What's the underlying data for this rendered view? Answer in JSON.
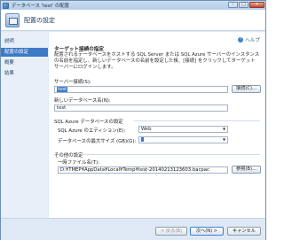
{
  "window": {
    "title": "データベース 'test' の配置",
    "controls": {
      "minimize": "–",
      "maximize": "□",
      "close": "✕"
    }
  },
  "header": {
    "title": "配置の設定"
  },
  "nav": {
    "items": [
      {
        "label": "説明",
        "selected": false
      },
      {
        "label": "配置の設定",
        "selected": true
      },
      {
        "label": "概要",
        "selected": false
      },
      {
        "label": "結果",
        "selected": false
      }
    ]
  },
  "help": {
    "label": "ヘルプ",
    "icon": "help-icon"
  },
  "target": {
    "section_title": "ターゲット接続の指定",
    "description": "配置されるデータベースをホストする SQL Server または SQL Azure サーバーのインスタンスの名前を指定し、新しいデータベースの名前を設定した後、[接続] をクリックしてターゲット サーバーにログインします。",
    "server_label": "サーバー接続(S):",
    "server_value": "test",
    "connect_button": "接続(C)...",
    "dbname_label": "新しいデータベース名(N):",
    "dbname_value": "test"
  },
  "azure": {
    "group_title": "SQL Azure データベースの設定",
    "edition_label": "SQL Azure のエディション(E):",
    "edition_value": "Web",
    "maxsize_label": "データベースの最大サイズ (GB)(G):",
    "maxsize_value": "1"
  },
  "other": {
    "group_title": "その他の設定",
    "tempfile_label": "一時ファイル名(T):",
    "tempfile_value": "D:¥TMEP¥AppData¥Local¥Temp¥test-20140213123603.bacpac",
    "browse_button": "参照(B)..."
  },
  "footer": {
    "back_button": "< 戻る(B)",
    "next_button": "次へ(N) >",
    "cancel_button": "キャンセル"
  }
}
